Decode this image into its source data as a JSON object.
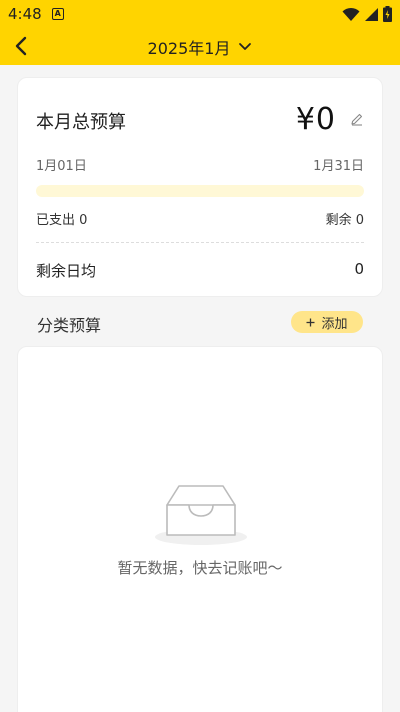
{
  "status_bar": {
    "time": "4:48",
    "notification_icon": "a-icon"
  },
  "header": {
    "month": "2025年1月",
    "back_icon": "chevron-left-icon",
    "dropdown_icon": "chevron-down-icon"
  },
  "budget": {
    "title": "本月总预算",
    "amount": "¥0",
    "start_date": "1月01日",
    "end_date": "1月31日",
    "spent_label": "已支出 0",
    "remaining_label": "剩余 0",
    "daily_label": "剩余日均",
    "daily_value": "0",
    "progress_percent": 0
  },
  "category": {
    "title": "分类预算",
    "add_label": "添加",
    "empty_text": "暂无数据，快去记账吧～"
  },
  "colors": {
    "accent": "#ffd400",
    "progress_track": "#fff8d6",
    "add_button": "#ffe58a"
  }
}
